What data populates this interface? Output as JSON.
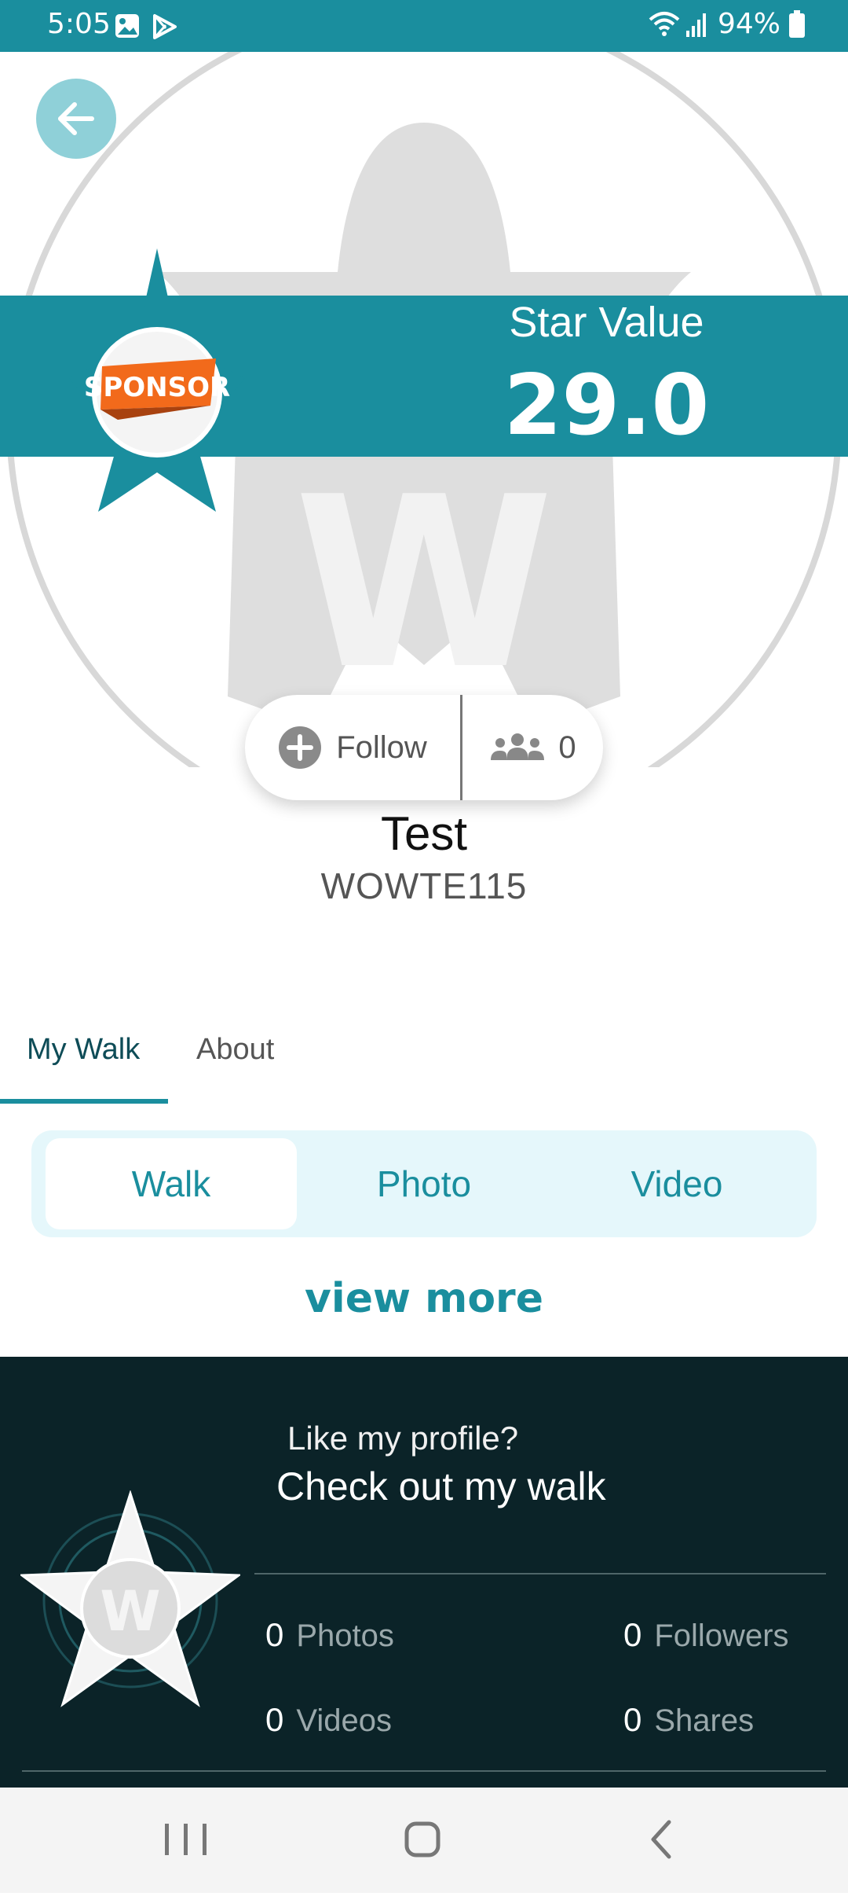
{
  "status_bar": {
    "time": "5:05",
    "battery_percent": "94%",
    "icons": [
      "gallery-icon",
      "play-store-icon",
      "wifi-icon",
      "signal-icon",
      "battery-icon"
    ]
  },
  "hero": {
    "star_value_label": "Star Value",
    "star_value": "29.0",
    "sponsor_badge_text": "SPONSOR"
  },
  "follow": {
    "follow_label": "Follow",
    "followers_count": "0"
  },
  "profile": {
    "name": "Test",
    "code": "WOWTE115"
  },
  "tabs": [
    {
      "label": "My Walk",
      "active": true
    },
    {
      "label": "About",
      "active": false
    }
  ],
  "segment": {
    "items": [
      "Walk",
      "Photo",
      "Video"
    ],
    "selected": "Walk"
  },
  "view_more": "view more",
  "panel": {
    "subtitle": "Like my profile?",
    "title": "Check out my walk",
    "stats": {
      "photos": {
        "count": "0",
        "label": "Photos"
      },
      "videos": {
        "count": "0",
        "label": "Videos"
      },
      "followers": {
        "count": "0",
        "label": "Followers"
      },
      "shares": {
        "count": "0",
        "label": "Shares"
      }
    }
  },
  "colors": {
    "primary": "#1a8e9e",
    "dark_panel": "#0b2328",
    "segment_bg": "#e5f7fb",
    "sponsor_orange": "#f26a1b"
  }
}
